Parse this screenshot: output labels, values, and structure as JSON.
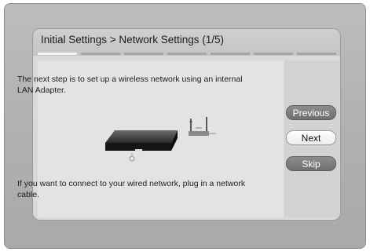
{
  "dialog": {
    "title": "Initial Settings > Network Settings (1/5)",
    "progress_steps_total": 5,
    "progress_steps_completed": 1
  },
  "content": {
    "message_main": "The next step is to set up a wireless network using an internal LAN Adapter.",
    "message_wired": "If you want to connect to your wired network, plug in a network cable."
  },
  "buttons": {
    "previous": "Previous",
    "next": "Next",
    "skip": "Skip",
    "selected": "next"
  },
  "illustration": {
    "device_icon": "blu-ray-player-icon",
    "antenna_icon": "wireless-antenna-icon"
  }
}
